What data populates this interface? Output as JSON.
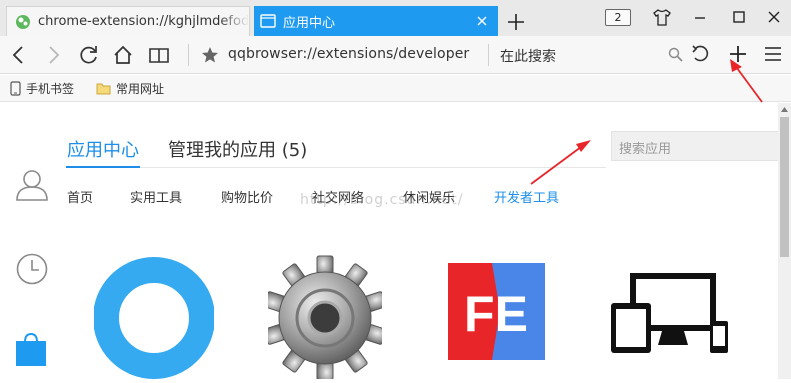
{
  "browser": {
    "tabs": [
      {
        "title": "chrome-extension://kghjlmdefodlja",
        "active": false
      },
      {
        "title": "应用中心",
        "active": true
      }
    ],
    "tab_count": "2",
    "address": "qqbrowser://extensions/developer",
    "search_placeholder": "在此搜索",
    "bookmarks": [
      "手机书签",
      "常用网址"
    ]
  },
  "page": {
    "main_tabs": [
      "应用中心",
      "管理我的应用 (5)"
    ],
    "app_search_placeholder": "搜索应用",
    "categories": [
      "首页",
      "实用工具",
      "购物比价",
      "社交网络",
      "休闲娱乐",
      "开发者工具"
    ],
    "selected_category": "开发者工具",
    "watermark": "http://blog.csdn.net/",
    "app_fe_logo_text": "FE"
  },
  "colors": {
    "accent": "#1e8ee8",
    "active_tab": "#1e9bf0",
    "annotation_arrow": "#e8262a",
    "fe_red": "#e8262a",
    "fe_blue": "#4a86e8",
    "ring_blue": "#35aaf0"
  },
  "icons": [
    "back-icon",
    "forward-icon",
    "reload-icon",
    "home-icon",
    "reader-icon",
    "star-icon",
    "search-icon",
    "undo-icon",
    "plus-icon",
    "menu-icon",
    "phone-icon",
    "folder-icon",
    "user-icon",
    "clock-icon",
    "bag-icon"
  ]
}
